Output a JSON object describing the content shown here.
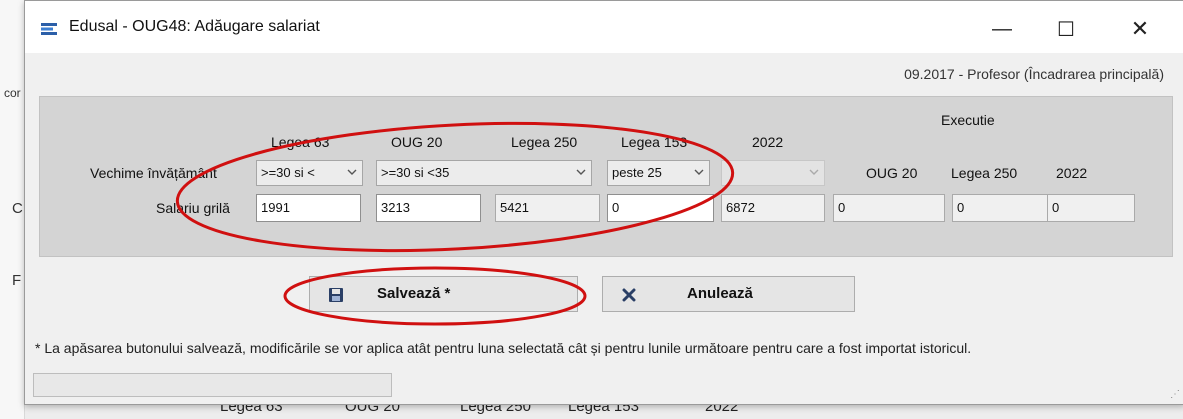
{
  "background": {
    "fragments": [
      "cor",
      "C",
      "F"
    ],
    "bottom_labels": [
      "Legea 63",
      "OUG 20",
      "Legea 250",
      "Legea 153",
      "2022"
    ]
  },
  "window": {
    "title": "Edusal - OUG48: Adăugare salariat",
    "minimize_glyph": "—",
    "maximize_glyph": "☐",
    "close_glyph": "✕"
  },
  "context_label": "09.2017 - Profesor (Încadrarea principală)",
  "panel": {
    "execution_header": "Executie",
    "columns": [
      "Legea 63",
      "OUG 20",
      "Legea 250",
      "Legea 153",
      "2022"
    ],
    "execution_columns": [
      "OUG 20",
      "Legea 250",
      "2022"
    ],
    "row_labels": {
      "vechime": "Vechime învățământ",
      "salariu": "Salariu grilă"
    },
    "vechime": {
      "legea63": ">=30 si <",
      "oug20": ">=30 si <35",
      "legea153": "peste 25",
      "y2022": ""
    },
    "salariu": {
      "legea63": "1991",
      "oug20": "3213",
      "legea250": "5421",
      "legea153": "0",
      "y2022": "6872",
      "exec_oug20": "0",
      "exec_legea250": "0",
      "exec_2022": "0"
    }
  },
  "buttons": {
    "save": "Salvează *",
    "cancel": "Anulează"
  },
  "note": "* La apăsarea butonului salvează, modificările se vor aplica atât pentru luna selectată cât și pentru lunile următoare pentru care a fost importat istoricul.",
  "colors": {
    "annotation_red": "#d01010",
    "panel_gray": "#d4d4d4",
    "window_bg": "#f0f0f0"
  },
  "icons": {
    "app": "edusal-app-icon",
    "save": "floppy-disk-icon",
    "cancel": "x-cancel-icon"
  }
}
